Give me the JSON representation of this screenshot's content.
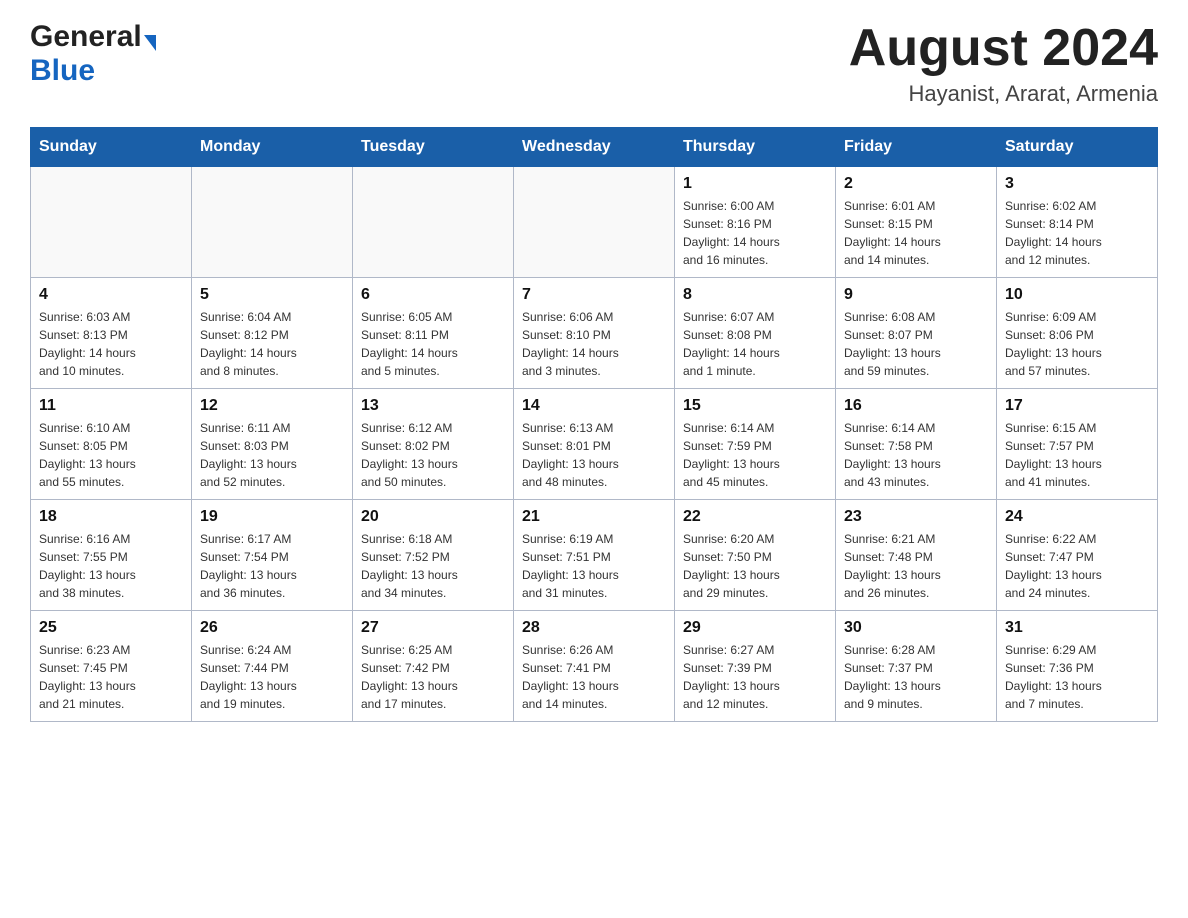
{
  "header": {
    "logo_general": "General",
    "logo_blue": "Blue",
    "month_title": "August 2024",
    "location": "Hayanist, Ararat, Armenia"
  },
  "days_of_week": [
    "Sunday",
    "Monday",
    "Tuesday",
    "Wednesday",
    "Thursday",
    "Friday",
    "Saturday"
  ],
  "weeks": [
    [
      {
        "day": "",
        "info": ""
      },
      {
        "day": "",
        "info": ""
      },
      {
        "day": "",
        "info": ""
      },
      {
        "day": "",
        "info": ""
      },
      {
        "day": "1",
        "info": "Sunrise: 6:00 AM\nSunset: 8:16 PM\nDaylight: 14 hours\nand 16 minutes."
      },
      {
        "day": "2",
        "info": "Sunrise: 6:01 AM\nSunset: 8:15 PM\nDaylight: 14 hours\nand 14 minutes."
      },
      {
        "day": "3",
        "info": "Sunrise: 6:02 AM\nSunset: 8:14 PM\nDaylight: 14 hours\nand 12 minutes."
      }
    ],
    [
      {
        "day": "4",
        "info": "Sunrise: 6:03 AM\nSunset: 8:13 PM\nDaylight: 14 hours\nand 10 minutes."
      },
      {
        "day": "5",
        "info": "Sunrise: 6:04 AM\nSunset: 8:12 PM\nDaylight: 14 hours\nand 8 minutes."
      },
      {
        "day": "6",
        "info": "Sunrise: 6:05 AM\nSunset: 8:11 PM\nDaylight: 14 hours\nand 5 minutes."
      },
      {
        "day": "7",
        "info": "Sunrise: 6:06 AM\nSunset: 8:10 PM\nDaylight: 14 hours\nand 3 minutes."
      },
      {
        "day": "8",
        "info": "Sunrise: 6:07 AM\nSunset: 8:08 PM\nDaylight: 14 hours\nand 1 minute."
      },
      {
        "day": "9",
        "info": "Sunrise: 6:08 AM\nSunset: 8:07 PM\nDaylight: 13 hours\nand 59 minutes."
      },
      {
        "day": "10",
        "info": "Sunrise: 6:09 AM\nSunset: 8:06 PM\nDaylight: 13 hours\nand 57 minutes."
      }
    ],
    [
      {
        "day": "11",
        "info": "Sunrise: 6:10 AM\nSunset: 8:05 PM\nDaylight: 13 hours\nand 55 minutes."
      },
      {
        "day": "12",
        "info": "Sunrise: 6:11 AM\nSunset: 8:03 PM\nDaylight: 13 hours\nand 52 minutes."
      },
      {
        "day": "13",
        "info": "Sunrise: 6:12 AM\nSunset: 8:02 PM\nDaylight: 13 hours\nand 50 minutes."
      },
      {
        "day": "14",
        "info": "Sunrise: 6:13 AM\nSunset: 8:01 PM\nDaylight: 13 hours\nand 48 minutes."
      },
      {
        "day": "15",
        "info": "Sunrise: 6:14 AM\nSunset: 7:59 PM\nDaylight: 13 hours\nand 45 minutes."
      },
      {
        "day": "16",
        "info": "Sunrise: 6:14 AM\nSunset: 7:58 PM\nDaylight: 13 hours\nand 43 minutes."
      },
      {
        "day": "17",
        "info": "Sunrise: 6:15 AM\nSunset: 7:57 PM\nDaylight: 13 hours\nand 41 minutes."
      }
    ],
    [
      {
        "day": "18",
        "info": "Sunrise: 6:16 AM\nSunset: 7:55 PM\nDaylight: 13 hours\nand 38 minutes."
      },
      {
        "day": "19",
        "info": "Sunrise: 6:17 AM\nSunset: 7:54 PM\nDaylight: 13 hours\nand 36 minutes."
      },
      {
        "day": "20",
        "info": "Sunrise: 6:18 AM\nSunset: 7:52 PM\nDaylight: 13 hours\nand 34 minutes."
      },
      {
        "day": "21",
        "info": "Sunrise: 6:19 AM\nSunset: 7:51 PM\nDaylight: 13 hours\nand 31 minutes."
      },
      {
        "day": "22",
        "info": "Sunrise: 6:20 AM\nSunset: 7:50 PM\nDaylight: 13 hours\nand 29 minutes."
      },
      {
        "day": "23",
        "info": "Sunrise: 6:21 AM\nSunset: 7:48 PM\nDaylight: 13 hours\nand 26 minutes."
      },
      {
        "day": "24",
        "info": "Sunrise: 6:22 AM\nSunset: 7:47 PM\nDaylight: 13 hours\nand 24 minutes."
      }
    ],
    [
      {
        "day": "25",
        "info": "Sunrise: 6:23 AM\nSunset: 7:45 PM\nDaylight: 13 hours\nand 21 minutes."
      },
      {
        "day": "26",
        "info": "Sunrise: 6:24 AM\nSunset: 7:44 PM\nDaylight: 13 hours\nand 19 minutes."
      },
      {
        "day": "27",
        "info": "Sunrise: 6:25 AM\nSunset: 7:42 PM\nDaylight: 13 hours\nand 17 minutes."
      },
      {
        "day": "28",
        "info": "Sunrise: 6:26 AM\nSunset: 7:41 PM\nDaylight: 13 hours\nand 14 minutes."
      },
      {
        "day": "29",
        "info": "Sunrise: 6:27 AM\nSunset: 7:39 PM\nDaylight: 13 hours\nand 12 minutes."
      },
      {
        "day": "30",
        "info": "Sunrise: 6:28 AM\nSunset: 7:37 PM\nDaylight: 13 hours\nand 9 minutes."
      },
      {
        "day": "31",
        "info": "Sunrise: 6:29 AM\nSunset: 7:36 PM\nDaylight: 13 hours\nand 7 minutes."
      }
    ]
  ]
}
